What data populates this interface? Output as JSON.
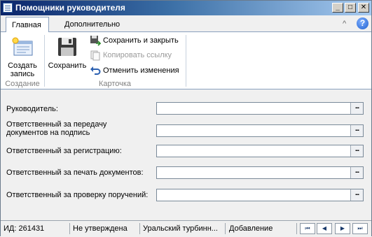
{
  "window": {
    "title": "Помощники руководителя"
  },
  "ribbon": {
    "tabs": [
      {
        "label": "Главная"
      },
      {
        "label": "Дополнительно"
      }
    ],
    "help_glyph": "?",
    "collapse_glyph": "^",
    "groups": {
      "create": {
        "label": "Создание",
        "create_button": "Создать запись"
      },
      "card": {
        "label": "Карточка",
        "save_button": "Сохранить",
        "save_close": "Сохранить и закрыть",
        "copy_link": "Копировать ссылку",
        "cancel_changes": "Отменить изменения"
      }
    }
  },
  "form": {
    "fields": [
      {
        "label": "Руководитель:",
        "value": ""
      },
      {
        "label": "Ответственный за передачу документов на подпись",
        "value": ""
      },
      {
        "label": "Ответственный за регистрацию:",
        "value": ""
      },
      {
        "label": "Ответственный за печать документов:",
        "value": ""
      },
      {
        "label": "Ответственный за проверку поручений:",
        "value": ""
      }
    ],
    "lookup_glyph": "..."
  },
  "status": {
    "id": "ИД: 261431",
    "state": "Не утверждена",
    "organization": "Уральский турбинн...",
    "mode": "Добавление"
  },
  "nav": {
    "first": "⏮",
    "prev": "◀",
    "next": "▶",
    "last": "⏭"
  },
  "titlebar_buttons": {
    "minimize": "_",
    "maximize": "□",
    "close": "✕"
  }
}
